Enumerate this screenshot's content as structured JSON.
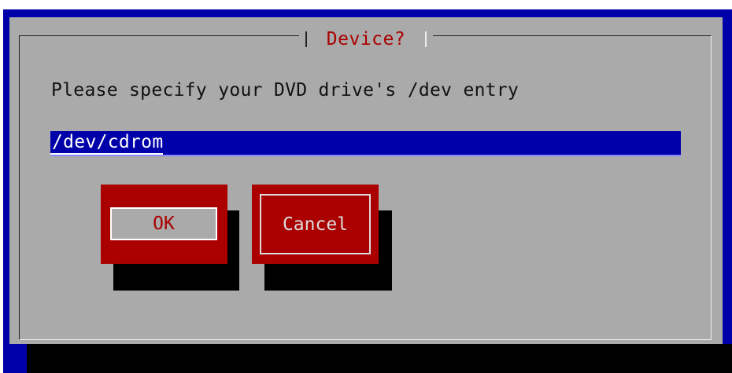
{
  "dialog": {
    "title": "Device?",
    "prompt": "Please specify your DVD drive's /dev entry",
    "entry_value": "/dev/cdrom"
  },
  "buttons": {
    "ok_label": "OK",
    "cancel_label": "Cancel"
  },
  "colors": {
    "screen_bg": "#0000aa",
    "dialog_bg": "#aaaaaa",
    "title_text": "#aa0000",
    "entry_bg": "#0000aa",
    "button_bg": "#aa0000",
    "shadow": "#000000"
  }
}
